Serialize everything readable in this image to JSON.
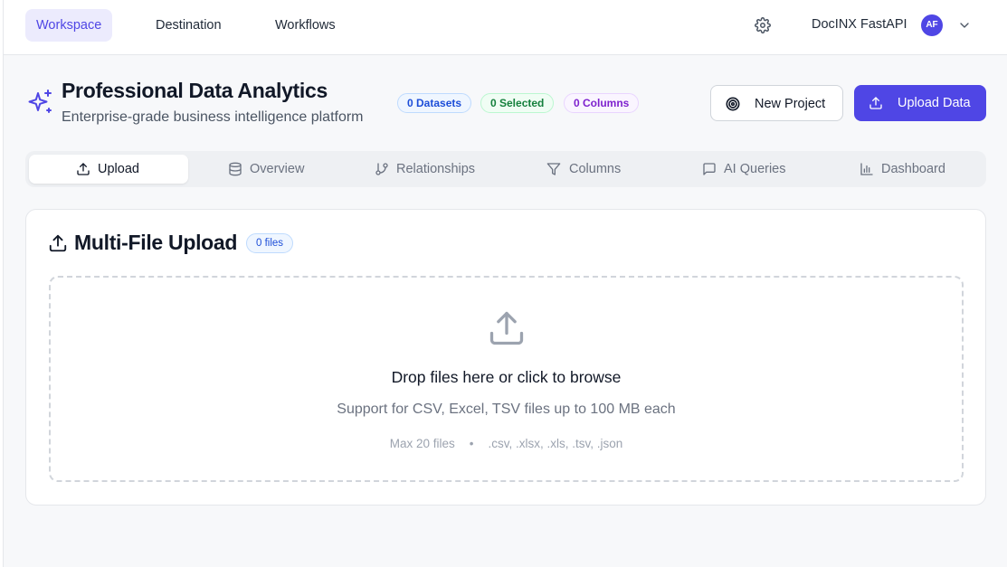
{
  "nav": {
    "tabs": [
      {
        "label": "Workspace"
      },
      {
        "label": "Destination"
      },
      {
        "label": "Workflows"
      }
    ],
    "org_name": "DocINX FastAPI",
    "avatar_initials": "AF"
  },
  "header": {
    "title": "Professional Data Analytics",
    "subtitle": "Enterprise-grade business intelligence platform",
    "badges": {
      "datasets": "0 Datasets",
      "selected": "0 Selected",
      "columns": "0 Columns"
    },
    "new_project_label": "New Project",
    "upload_data_label": "Upload Data"
  },
  "tabs": [
    {
      "label": "Upload",
      "icon": "upload-icon"
    },
    {
      "label": "Overview",
      "icon": "database-icon"
    },
    {
      "label": "Relationships",
      "icon": "git-branch-icon"
    },
    {
      "label": "Columns",
      "icon": "filter-icon"
    },
    {
      "label": "AI Queries",
      "icon": "message-icon"
    },
    {
      "label": "Dashboard",
      "icon": "bar-chart-icon"
    }
  ],
  "upload_card": {
    "title": "Multi-File Upload",
    "files_badge": "0 files",
    "drop_text": "Drop files here or click to browse",
    "support_text": "Support for CSV, Excel, TSV files up to 100 MB each",
    "max_files": "Max 20 files",
    "separator": "•",
    "extensions": ".csv, .xlsx, .xls, .tsv, .json"
  },
  "colors": {
    "accent": "#4f46e5",
    "accent_light": "#ecebfd"
  }
}
